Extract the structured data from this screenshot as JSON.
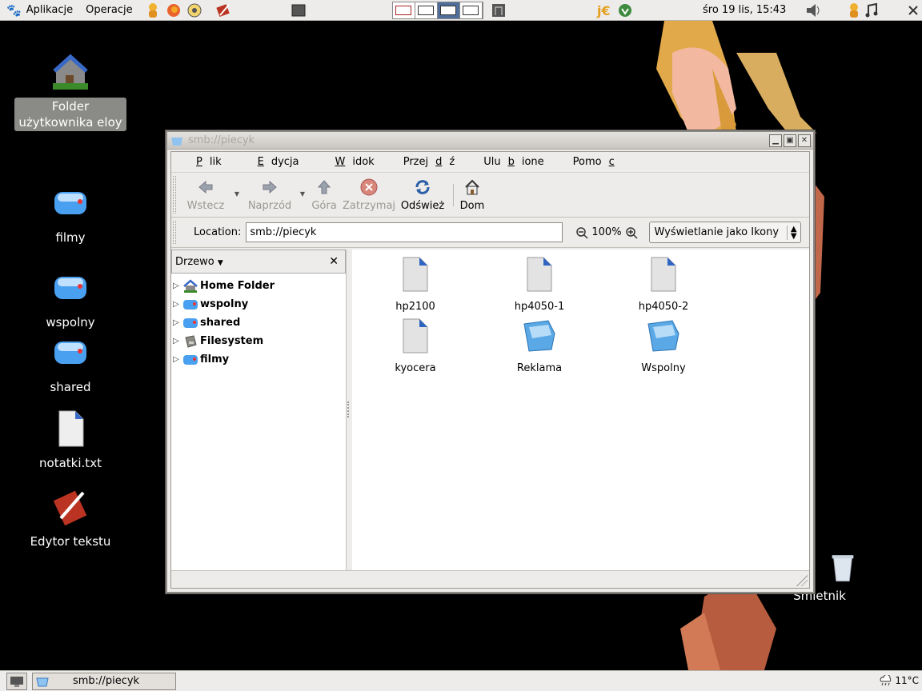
{
  "top_panel": {
    "apps_menu": "Aplikacje",
    "actions_menu": "Operacje",
    "clock": "śro 19 lis, 15:43"
  },
  "desktop": {
    "icons": [
      {
        "label": "Folder użytkownika eloy",
        "icon": "home-folder-icon"
      },
      {
        "label": "filmy",
        "icon": "network-share-icon"
      },
      {
        "label": "wspolny",
        "icon": "network-share-icon"
      },
      {
        "label": "shared",
        "icon": "network-share-icon"
      },
      {
        "label": "notatki.txt",
        "icon": "text-file-icon"
      },
      {
        "label": "Edytor tekstu",
        "icon": "text-editor-icon"
      },
      {
        "label": "Smietnik",
        "icon": "trash-icon"
      }
    ]
  },
  "window": {
    "title": "smb://piecyk",
    "menu": [
      {
        "pre": "",
        "u": "P",
        "post": "lik"
      },
      {
        "pre": "",
        "u": "E",
        "post": "dycja"
      },
      {
        "pre": "",
        "u": "W",
        "post": "idok"
      },
      {
        "pre": "Przej",
        "u": "d",
        "post": "ź"
      },
      {
        "pre": "Ulu",
        "u": "b",
        "post": "ione"
      },
      {
        "pre": "Pomo",
        "u": "c",
        "post": ""
      }
    ],
    "toolbar": {
      "back": "Wstecz",
      "forward": "Naprzód",
      "up": "Góra",
      "stop": "Zatrzymaj",
      "reload": "Odśwież",
      "home": "Dom"
    },
    "location": {
      "label": "Location:",
      "value": "smb://piecyk",
      "zoom": "100%",
      "view_mode": "Wyświetlanie jako Ikony"
    },
    "sidebar": {
      "title": "Drzewo",
      "tree": [
        "Home Folder",
        "wspolny",
        "shared",
        "Filesystem",
        "filmy"
      ]
    },
    "files": [
      {
        "name": "hp2100",
        "icon": "printer-share-icon"
      },
      {
        "name": "hp4050-1",
        "icon": "printer-share-icon"
      },
      {
        "name": "hp4050-2",
        "icon": "printer-share-icon"
      },
      {
        "name": "kyocera",
        "icon": "printer-share-icon"
      },
      {
        "name": "Reklama",
        "icon": "folder-share-icon"
      },
      {
        "name": "Wspolny",
        "icon": "folder-share-icon"
      }
    ]
  },
  "bottom_panel": {
    "task": "smb://piecyk",
    "weather": "11°C"
  },
  "colors": {
    "desktop_bg": "#000000",
    "panel_bg": "#eeecea",
    "accent": "#4f6e9c"
  }
}
